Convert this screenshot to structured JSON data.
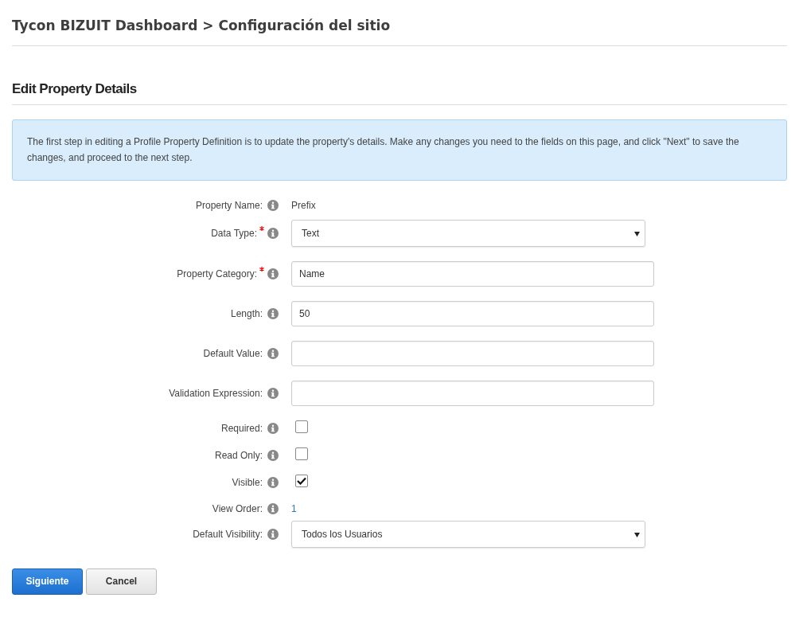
{
  "page_title": "Tycon BIZUIT Dashboard > Configuración del sitio",
  "section_title": "Edit Property Details",
  "info_text": "The first step in editing a Profile Property Definition is to update the property's details. Make any changes you need to the fields on this page, and click \"Next\" to save the changes, and proceed to the next step.",
  "fields": [
    {
      "kind": "static",
      "label": "Property Name:",
      "required": false,
      "value": "Prefix"
    },
    {
      "kind": "select",
      "label": "Data Type:",
      "required": true,
      "value": "Text"
    },
    {
      "kind": "text",
      "label": "Property Category:",
      "required": true,
      "value": "Name"
    },
    {
      "kind": "text",
      "label": "Length:",
      "required": false,
      "value": "50"
    },
    {
      "kind": "text",
      "label": "Default Value:",
      "required": false
    },
    {
      "kind": "text",
      "label": "Validation Expression:",
      "required": false
    },
    {
      "kind": "checkbox",
      "label": "Required:",
      "required": false,
      "checked": false
    },
    {
      "kind": "checkbox",
      "label": "Read Only:",
      "required": false,
      "checked": false
    },
    {
      "kind": "checkbox",
      "label": "Visible:",
      "required": false,
      "checked": true
    },
    {
      "kind": "link",
      "label": "View Order:",
      "required": false,
      "value": "1"
    },
    {
      "kind": "select",
      "label": "Default Visibility:",
      "required": false,
      "value": "Todos los Usuarios"
    }
  ],
  "buttons": [
    {
      "label": "Siguiente",
      "kind": "primary"
    },
    {
      "label": "Cancel",
      "kind": "secondary"
    }
  ]
}
